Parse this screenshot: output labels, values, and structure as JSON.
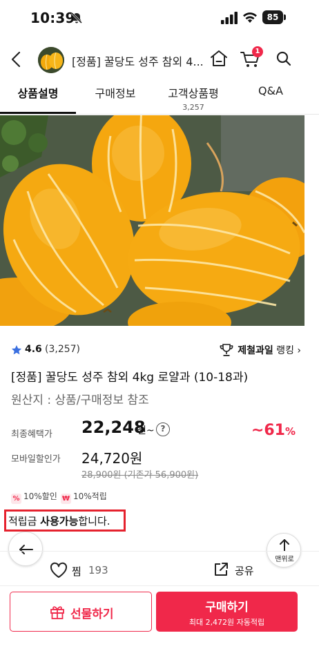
{
  "status_bar": {
    "time": "10:39",
    "battery": "85"
  },
  "header": {
    "title": "[정품] 꿀당도 성주 참외 4...",
    "cart_badge": "1"
  },
  "tabs": [
    {
      "label": "상품설명",
      "sub": ""
    },
    {
      "label": "구매정보",
      "sub": ""
    },
    {
      "label": "고객상품평",
      "sub": "3,257"
    },
    {
      "label": "Q&A",
      "sub": ""
    }
  ],
  "product": {
    "rating": "4.6",
    "rating_count": "(3,257)",
    "ranking_bold": "제철과일",
    "ranking_rest": " 랭킹 ›",
    "title": "[정품] 꿀당도 성주 참외 4kg 로얄과 (10-18과)",
    "origin": "원산지 : 상품/구매정보 참조"
  },
  "pricing": {
    "final_label": "최종혜택가",
    "final_price": "22,248",
    "final_suffix": "원~",
    "help": "?",
    "discount_value": "~61",
    "discount_unit": "%",
    "mobile_label": "모바일할인가",
    "mobile_price": "24,720원",
    "original": "28,900원 (기존가 56,900원)"
  },
  "chips": [
    {
      "icon": "%",
      "text": "10%할인"
    },
    {
      "icon": "₩",
      "text": "10%적립"
    }
  ],
  "points": {
    "prefix": "적립금 ",
    "bold": "사용가능",
    "suffix": "합니다."
  },
  "float": {
    "top_label": "맨위로"
  },
  "actions": {
    "wish_label": "찜",
    "wish_count": "193",
    "share_label": "공유"
  },
  "bottom": {
    "gift_label": "선물하기",
    "buy_label": "구매하기",
    "buy_sub": "최대 2,472원 자동적립"
  },
  "colors": {
    "accent": "#f0284a",
    "highlight_box": "#e5222e",
    "star": "#3a6fe0"
  }
}
